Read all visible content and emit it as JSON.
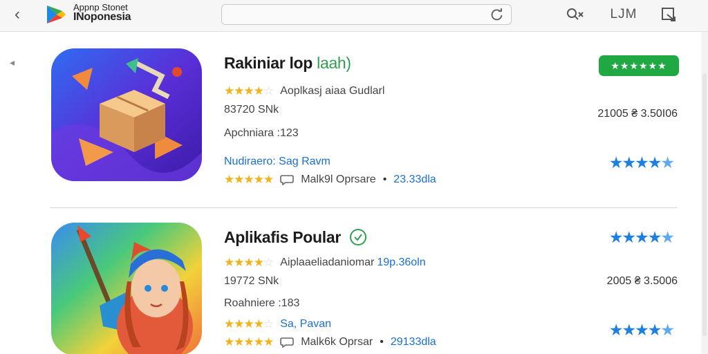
{
  "header": {
    "store_name_line1": "Appnp Stonet",
    "store_name_line2": "INoponesia",
    "search_placeholder": "",
    "lim_label": "LJM"
  },
  "apps": [
    {
      "title": "Rakiniar lop",
      "title_suffix": "laah)",
      "category": "Aoplkasj aiaa Gudlarl",
      "size": "83720 SNk",
      "version": "Apchniara :123",
      "developer": "Nudiraero: Sag Ravm",
      "meta": "Malk9l Oprsare",
      "meta_count": "23.33dla",
      "top_badge_stars": "★★★★★★",
      "price": "21005 ₴ 3.50I06",
      "rating_stars": 4,
      "rating_stars_2": 5,
      "blue_rating": 4.5
    },
    {
      "title": "Aplikafis Poular",
      "title_suffix": "",
      "category": "Aiplaaeliadaniomar",
      "category_suffix": "19p.36oln",
      "size": "19772 SNk",
      "version": "Roahniere :183",
      "developer": "Sa, Pavan",
      "meta": "Malk6k Oprsar",
      "meta_count": "29133dla",
      "price": "2005 ₴ 3.5006",
      "rating_stars": 4.5,
      "rating_stars_2": 5,
      "blue_rating": 4.5,
      "blue_rating_2": 4.5
    }
  ],
  "colors": {
    "accent_green": "#20a943",
    "link_blue": "#1a6fd0",
    "star_gold": "#f3b21b",
    "star_blue": "#1d7fe0"
  }
}
